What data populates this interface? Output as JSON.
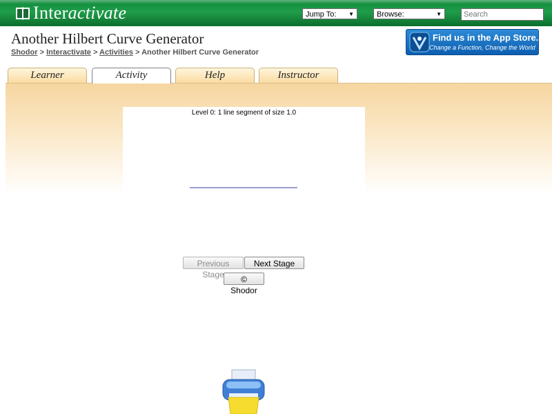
{
  "topbar": {
    "logo": {
      "prefix": "Inter",
      "suffix": "activate",
      "icon": "book-logo-icon"
    },
    "jump_to": "Jump To:",
    "browse": "Browse:",
    "search_placeholder": "Search"
  },
  "header": {
    "title": "Another Hilbert Curve Generator",
    "breadcrumb": [
      {
        "label": "Shodor",
        "link": true
      },
      {
        "label": "Interactivate",
        "link": true
      },
      {
        "label": "Activities",
        "link": true
      },
      {
        "label": "Another Hilbert Curve Generator",
        "link": false
      }
    ],
    "separator": ">",
    "appstore": {
      "line1": "Find us in the App Store.",
      "line2": "Change a Function, Change the World"
    }
  },
  "tabs": [
    {
      "label": "Learner",
      "active": false
    },
    {
      "label": "Activity",
      "active": true
    },
    {
      "label": "Help",
      "active": false
    },
    {
      "label": "Instructor",
      "active": false
    }
  ],
  "applet": {
    "status": "Level 0: 1 line segment of size 1.0",
    "level": 0,
    "curve_color": "#3a3aa8"
  },
  "buttons": {
    "previous": "Previous Stage",
    "previous_enabled": false,
    "next": "Next Stage",
    "shodor": "© Shodor"
  },
  "colors": {
    "topbar_green": "#1f9d4a",
    "tab_band": "#f6d6a0",
    "appstore_blue": "#1a72c4"
  }
}
